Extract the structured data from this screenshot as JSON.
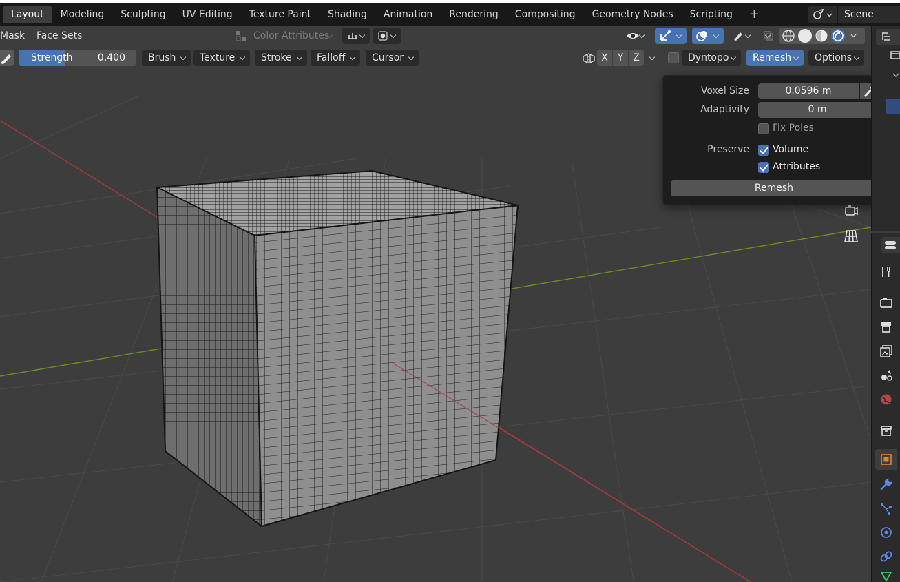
{
  "workspace_tabs": [
    "Layout",
    "Modeling",
    "Sculpting",
    "UV Editing",
    "Texture Paint",
    "Shading",
    "Animation",
    "Rendering",
    "Compositing",
    "Geometry Nodes",
    "Scripting"
  ],
  "add_workspace": "+",
  "scene": {
    "name": "Scene",
    "icon": "scene-icon"
  },
  "header_row1": {
    "mask": "Mask",
    "face_sets": "Face Sets",
    "color_attributes": "Color Attributes",
    "icons": [
      "transform-icon",
      "pivot-icon",
      "visibility-icon",
      "gizmo-icon",
      "overlay-icon",
      "xray-icon",
      "wireframe-shading-icon",
      "solid-shading-icon",
      "material-shading-icon",
      "rendered-shading-icon"
    ]
  },
  "header_row2": {
    "strength_label": "Strength",
    "strength_value": "0.400",
    "strength_fraction": 0.4,
    "menus": [
      "Brush",
      "Texture",
      "Stroke",
      "Falloff",
      "Cursor"
    ],
    "axes": [
      "X",
      "Y",
      "Z"
    ],
    "dyntopo": "Dyntopo",
    "remesh": "Remesh",
    "options": "Options"
  },
  "remesh_popover": {
    "voxel_size_label": "Voxel Size",
    "voxel_size_value": "0.0596 m",
    "adaptivity_label": "Adaptivity",
    "adaptivity_value": "0 m",
    "fix_poles": {
      "label": "Fix Poles",
      "checked": false
    },
    "preserve_label": "Preserve",
    "preserve_volume": {
      "label": "Volume",
      "checked": true
    },
    "preserve_attributes": {
      "label": "Attributes",
      "checked": true
    },
    "action": "Remesh"
  },
  "properties_tabs": [
    "tool-icon",
    "render-icon",
    "output-icon",
    "view-layer-icon",
    "scene-props-icon",
    "world-icon",
    "collection-icon",
    "object-icon",
    "modifier-icon",
    "particles-icon",
    "physics-icon",
    "constraints-icon",
    "data-icon"
  ],
  "colors": {
    "accent": "#4772b3",
    "x_axis": "#a53a40",
    "y_axis": "#6b8e23"
  }
}
